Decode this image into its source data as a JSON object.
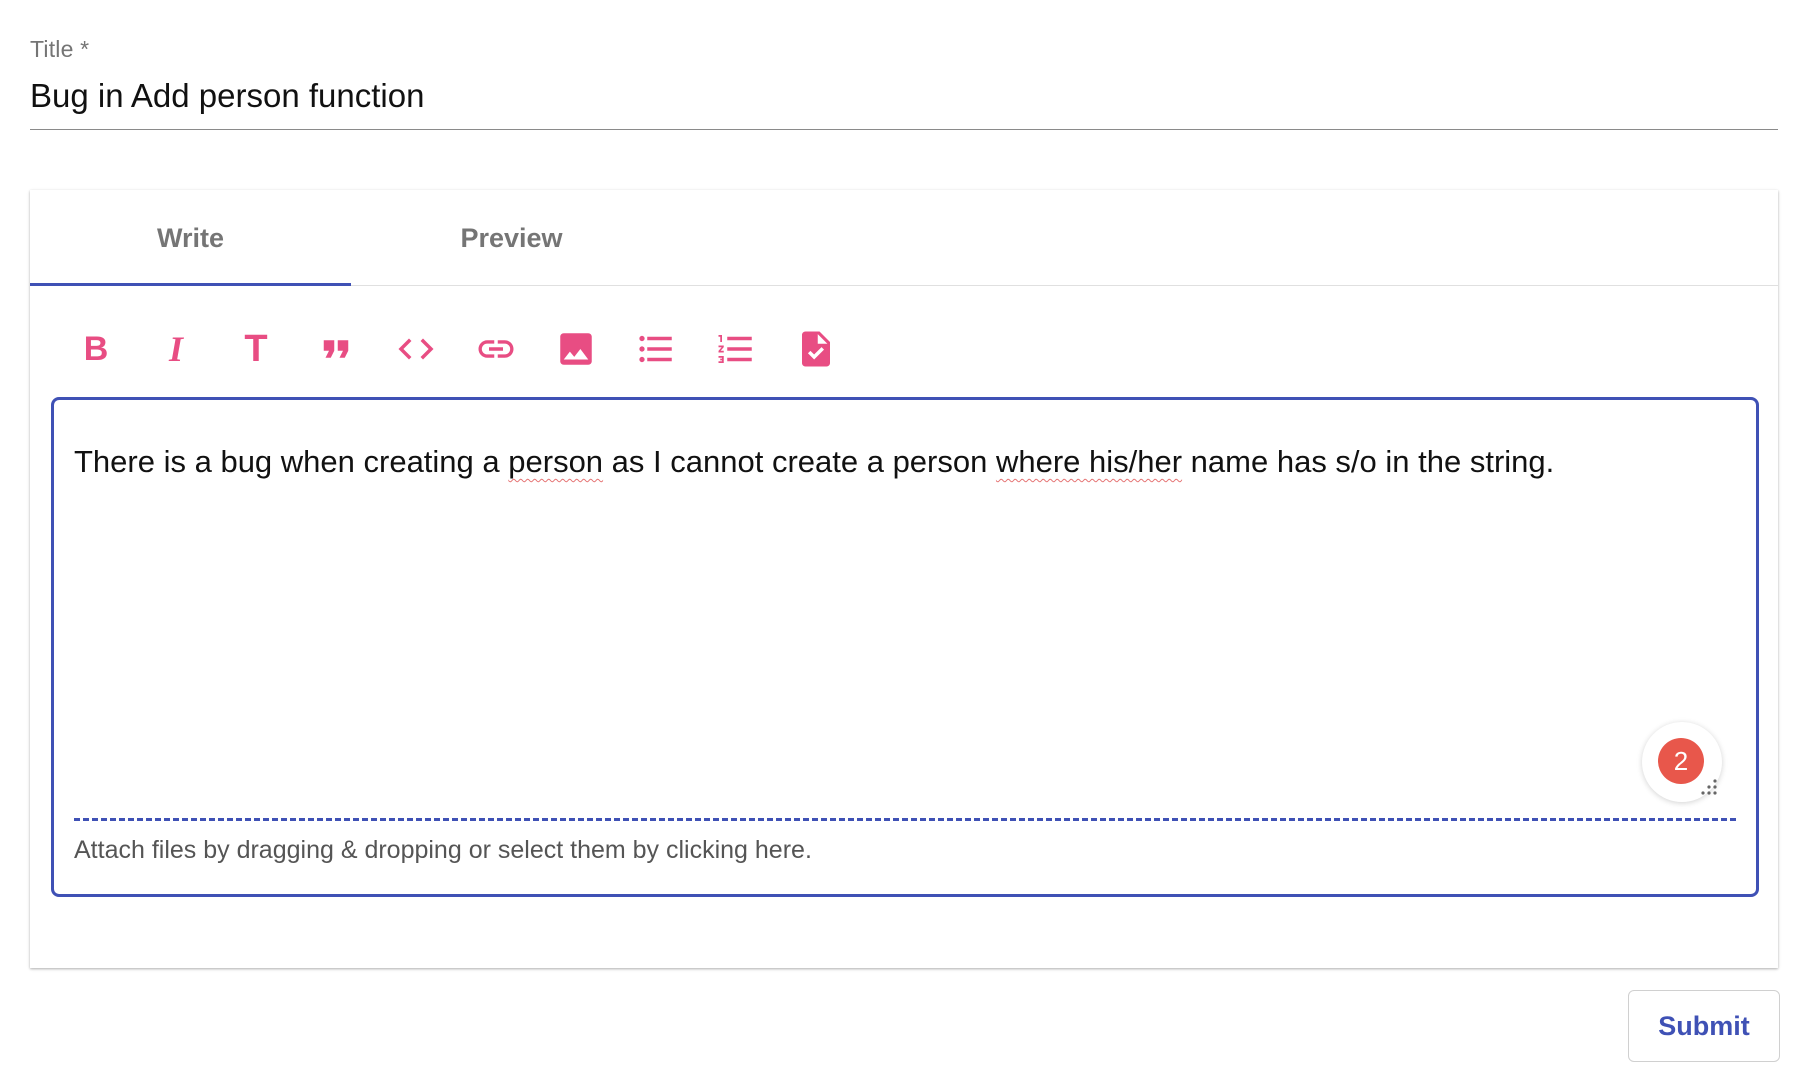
{
  "title_field": {
    "label": "Title *",
    "value": "Bug in Add person function"
  },
  "tabs": [
    {
      "label": "Write",
      "active": true
    },
    {
      "label": "Preview",
      "active": false
    }
  ],
  "toolbar": {
    "icons": [
      "bold-icon",
      "italic-icon",
      "heading-icon",
      "quote-icon",
      "code-icon",
      "link-icon",
      "image-icon",
      "bulleted-list-icon",
      "numbered-list-icon",
      "task-list-icon"
    ],
    "bold_glyph": "B",
    "italic_glyph": "I",
    "heading_glyph": "T",
    "accent_color": "#e84d83"
  },
  "editor": {
    "text_segments": [
      "There is a bug when creating a ",
      "person",
      " as I cannot create a person ",
      "where his/her",
      " name has s/o in the string."
    ],
    "notification_count": "2",
    "attach_hint": "Attach files by dragging & dropping or select them by clicking here.",
    "border_color": "#3f51b5"
  },
  "submit_label": "Submit"
}
